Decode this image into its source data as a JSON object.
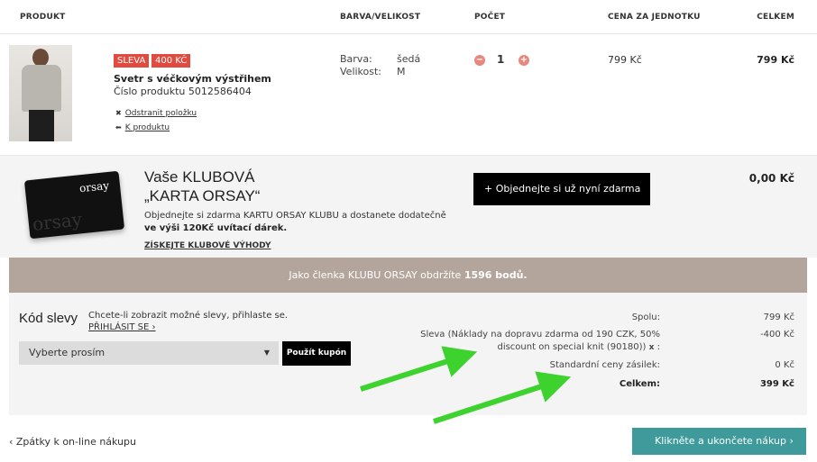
{
  "header": {
    "col_product": "PRODUKT",
    "col_color_size": "BARVA/VELIKOST",
    "col_count": "POČET",
    "col_unit_price": "CENA ZA JEDNOTKU",
    "col_total": "CELKEM"
  },
  "product": {
    "sale_label": "SLEVA",
    "sale_amount": "400 KČ",
    "name": "Svetr s véčkovým výstřihem",
    "number": "Číslo produktu 5012586404",
    "remove_label": "Odstranit položku",
    "to_product_label": "K produktu",
    "color_label": "Barva:",
    "color_value": "šedá",
    "size_label": "Velikost:",
    "size_value": "M",
    "quantity": "1",
    "minus_label": "−",
    "plus_label": "+",
    "unit_price": "799 Kč",
    "total": "799 Kč"
  },
  "club": {
    "card_logo": "orsay",
    "title_line1": "Vaše KLUBOVÁ",
    "title_line2": "„KARTA ORSAY“",
    "desc_part1": "Objednejte si zdarma KARTU ORSAY KLUBU a dostanete dodatečně",
    "desc_bold": "ve výši 120Kč uvítací dárek.",
    "link": "ZÍSKEJTE KLUBOVÉ VÝHODY",
    "order_button": "+   Objednejte si už nyní zdarma",
    "price": "0,00 Kč"
  },
  "banner": {
    "text": "Jako členka KLUBU ORSAY obdržíte",
    "points": "1596 bodů."
  },
  "coupon": {
    "title": "Kód slevy",
    "hint": "Chcete-li zobrazit možné slevy, přihlaste se.",
    "login_link": "PŘIHLÁSIT SE ›",
    "select_value": "Vyberte prosím",
    "apply_button": "Použít kupón"
  },
  "summary": {
    "subtotal_label": "Spolu:",
    "subtotal_value": "799 Kč",
    "discount_label_line1": "Sleva (Náklady na dopravu zdarma od 190 CZK, 50%",
    "discount_label_line2": "discount on special knit (90180))",
    "discount_remove": "x",
    "discount_value": "-400 Kč",
    "shipping_label": "Standardní ceny zásilek:",
    "shipping_value": "0 Kč",
    "total_label": "Celkem:",
    "total_value": "399 Kč"
  },
  "footer": {
    "back_link": "‹  Zpátky k on-line nákupu",
    "checkout_button": "Klikněte a ukončete nákup   ›"
  },
  "colors": {
    "sale_red": "#e04a3f",
    "banner_taupe": "#b3a59b",
    "checkout_teal": "#3e9a9b",
    "arrow_green": "#3ed22e"
  }
}
